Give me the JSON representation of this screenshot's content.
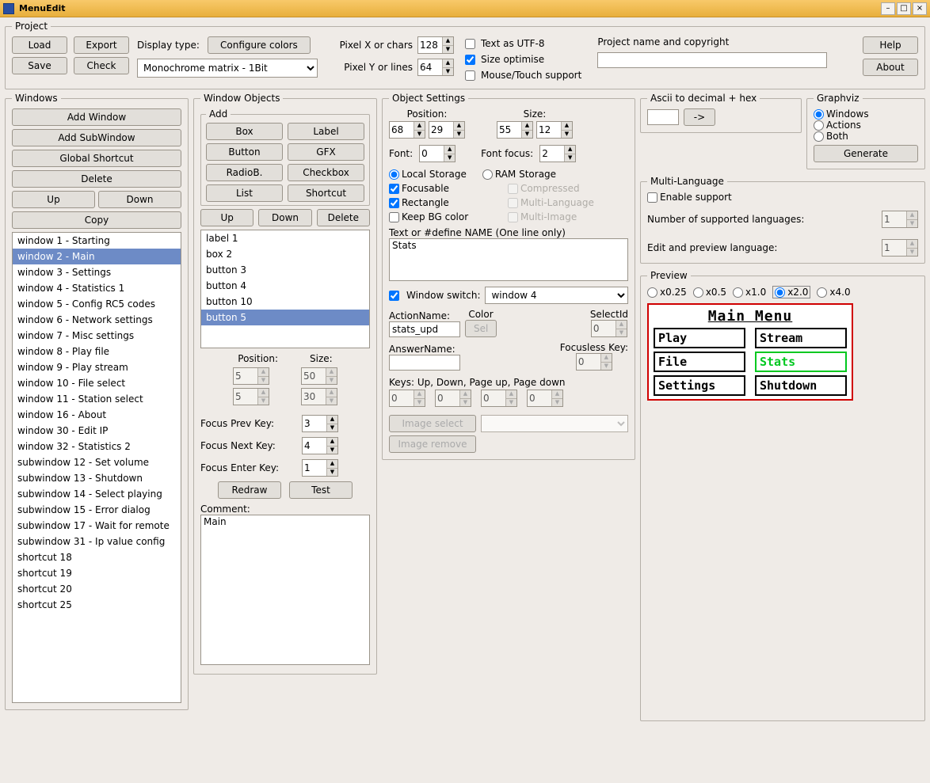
{
  "app": {
    "title": "MenuEdit"
  },
  "project": {
    "legend": "Project",
    "load": "Load",
    "export": "Export",
    "save": "Save",
    "check": "Check",
    "display_type_lbl": "Display type:",
    "configure_colors": "Configure colors",
    "display_type_sel": "Monochrome matrix - 1Bit",
    "px_x_lbl": "Pixel X or chars",
    "px_x": "128",
    "px_y_lbl": "Pixel Y or lines",
    "px_y": "64",
    "utf8_lbl": "Text as UTF-8",
    "sizeopt_lbl": "Size optimise",
    "mouse_lbl": "Mouse/Touch support",
    "name_lbl": "Project name and copyright",
    "name_val": "",
    "help": "Help",
    "about": "About"
  },
  "windows": {
    "legend": "Windows",
    "add_window": "Add Window",
    "add_subwindow": "Add SubWindow",
    "global_shortcut": "Global Shortcut",
    "delete": "Delete",
    "up": "Up",
    "down": "Down",
    "copy": "Copy",
    "items": [
      "window 1 - Starting",
      "window 2 - Main",
      "window 3 - Settings",
      "window 4 - Statistics 1",
      "window 5 - Config RC5 codes",
      "window 6 - Network settings",
      "window 7 - Misc settings",
      "window 8 - Play file",
      "window 9 - Play stream",
      "window 10 - File select",
      "window 11 - Station select",
      "window 16 - About",
      "window 30 - Edit IP",
      "window 32 - Statistics 2",
      "subwindow 12 - Set volume",
      "subwindow 13 - Shutdown",
      "subwindow 14 - Select playing",
      "subwindow 15 - Error dialog",
      "subwindow 17 - Wait for remote",
      "subwindow 31 - Ip value config",
      "shortcut 18",
      "shortcut 19",
      "shortcut 20",
      "shortcut 25"
    ],
    "selected_index": 1
  },
  "wobjects": {
    "legend": "Window Objects",
    "add_legend": "Add",
    "btns": {
      "box": "Box",
      "label": "Label",
      "button": "Button",
      "gfx": "GFX",
      "radiob": "RadioB.",
      "checkbox": "Checkbox",
      "list": "List",
      "shortcut": "Shortcut"
    },
    "up": "Up",
    "down": "Down",
    "delete": "Delete",
    "items": [
      "label 1",
      "box 2",
      "button 3",
      "button 4",
      "button 10",
      "button 5"
    ],
    "selected_index": 5,
    "pos_lbl": "Position:",
    "size_lbl": "Size:",
    "pos_x": "5",
    "pos_y": "5",
    "size_w": "50",
    "size_h": "30",
    "fprev_lbl": "Focus Prev Key:",
    "fprev": "3",
    "fnext_lbl": "Focus Next Key:",
    "fnext": "4",
    "fenter_lbl": "Focus Enter Key:",
    "fenter": "1",
    "redraw": "Redraw",
    "test": "Test",
    "comment_lbl": "Comment:",
    "comment": "Main"
  },
  "osettings": {
    "legend": "Object Settings",
    "position_lbl": "Position:",
    "size_lbl": "Size:",
    "pos_x": "68",
    "pos_y": "29",
    "size_w": "55",
    "size_h": "12",
    "font_lbl": "Font:",
    "font": "0",
    "fontfocus_lbl": "Font focus:",
    "fontfocus": "2",
    "local_storage": "Local Storage",
    "ram_storage": "RAM Storage",
    "focusable": "Focusable",
    "compressed": "Compressed",
    "rectangle": "Rectangle",
    "multilang": "Multi-Language",
    "keep_bg": "Keep BG color",
    "multiimg": "Multi-Image",
    "textdef_lbl": "Text or #define NAME (One line only)",
    "text": "Stats",
    "winswitch_lbl": "Window switch:",
    "winswitch_sel": "window 4",
    "actionname_lbl": "ActionName:",
    "actionname": "stats_upd",
    "color_lbl": "Color",
    "color_btn": "Sel",
    "selectid_lbl": "SelectId",
    "selectid": "0",
    "answername_lbl": "AnswerName:",
    "answername": "",
    "focusless_lbl": "Focusless Key:",
    "focusless": "0",
    "keys_lbl": "Keys: Up, Down, Page up, Page down",
    "k1": "0",
    "k2": "0",
    "k3": "0",
    "k4": "0",
    "imgsel": "Image select",
    "imgrem": "Image remove"
  },
  "ascii": {
    "legend": "Ascii to decimal + hex",
    "val": "",
    "go": "->"
  },
  "graphviz": {
    "legend": "Graphviz",
    "windows": "Windows",
    "actions": "Actions",
    "both": "Both",
    "generate": "Generate"
  },
  "ml": {
    "legend": "Multi-Language",
    "enable": "Enable support",
    "numlang_lbl": "Number of supported languages:",
    "numlang": "1",
    "editlang_lbl": "Edit and preview language:",
    "editlang": "1"
  },
  "preview": {
    "legend": "Preview",
    "zooms": {
      "x025": "x0.25",
      "x05": "x0.5",
      "x10": "x1.0",
      "x20": "x2.0",
      "x40": "x4.0"
    },
    "title": "Main Menu",
    "buttons": [
      "Play",
      "Stream",
      "File",
      "Stats",
      "Settings",
      "Shutdown"
    ],
    "focus_index": 3
  }
}
